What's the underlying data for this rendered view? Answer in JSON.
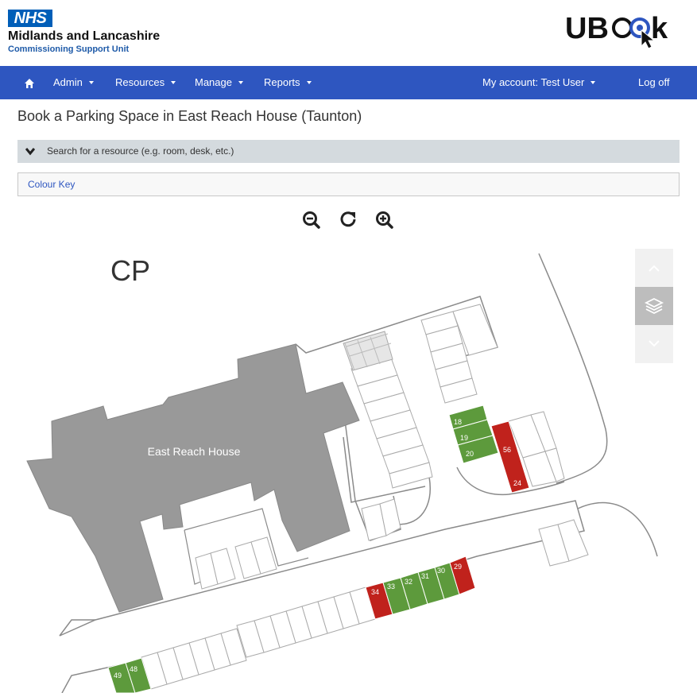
{
  "header": {
    "nhs_logo": "NHS",
    "org_name": "Midlands and Lancashire",
    "org_sub": "Commissioning Support Unit",
    "app_logo": "UBook"
  },
  "nav": {
    "home_icon": "home-icon",
    "admin": "Admin",
    "resources": "Resources",
    "manage": "Manage",
    "reports": "Reports",
    "account": "My account: Test User",
    "logoff": "Log off"
  },
  "page": {
    "title": "Book a Parking Space in East Reach House (Taunton)",
    "search_toggle": "Search for a resource (e.g. room, desk, etc.)",
    "colour_key": "Colour Key"
  },
  "map": {
    "zone_label": "CP",
    "building_label": "East Reach House",
    "colors": {
      "available": "#5d9a3c",
      "booked": "#c0221c",
      "building": "#9a9a9a",
      "nav": "#2e56c0"
    },
    "available_spaces": [
      "18",
      "19",
      "20",
      "33",
      "32",
      "31",
      "30",
      "49",
      "48"
    ],
    "booked_spaces": [
      "56",
      "24",
      "34",
      "29"
    ]
  },
  "controls": {
    "zoom_out": "zoom-out-icon",
    "reset": "refresh-icon",
    "zoom_in": "zoom-in-icon",
    "layer_up": "chevron-up-icon",
    "layers": "layers-icon",
    "layer_down": "chevron-down-icon"
  }
}
